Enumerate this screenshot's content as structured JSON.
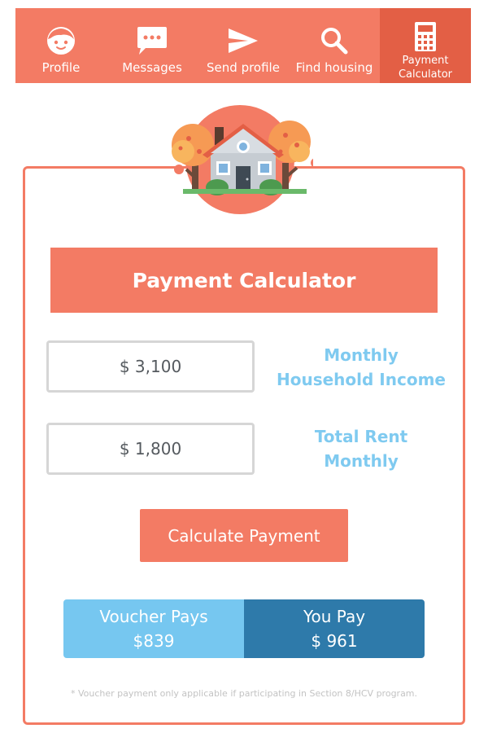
{
  "nav": {
    "items": [
      {
        "label": "Profile",
        "icon": "face-icon"
      },
      {
        "label": "Messages",
        "icon": "chat-bubble-icon"
      },
      {
        "label": "Send profile",
        "icon": "paper-plane-icon"
      },
      {
        "label": "Find housing",
        "icon": "search-icon"
      },
      {
        "label_line1": "Payment",
        "label_line2": "Calculator",
        "icon": "calculator-icon",
        "active": true
      }
    ]
  },
  "calculator": {
    "title": "Payment Calculator",
    "income_value": "$ 3,100",
    "income_label_line1": "Monthly",
    "income_label_line2": "Household Income",
    "rent_value": "$ 1,800",
    "rent_label_line1": "Total Rent",
    "rent_label_line2": "Monthly",
    "calculate_label": "Calculate Payment"
  },
  "result": {
    "voucher_label": "Voucher Pays",
    "voucher_amount": "$839",
    "you_label": "You Pay",
    "you_amount": "$ 961"
  },
  "footnote": "* Voucher payment only applicable if participating in Section 8/HCV program.",
  "colors": {
    "accent": "#f37b64",
    "accent_dark": "#e35f45",
    "light_blue": "#76c7f0",
    "dark_blue": "#2e7aaa",
    "label_blue": "#7fcaf0"
  }
}
